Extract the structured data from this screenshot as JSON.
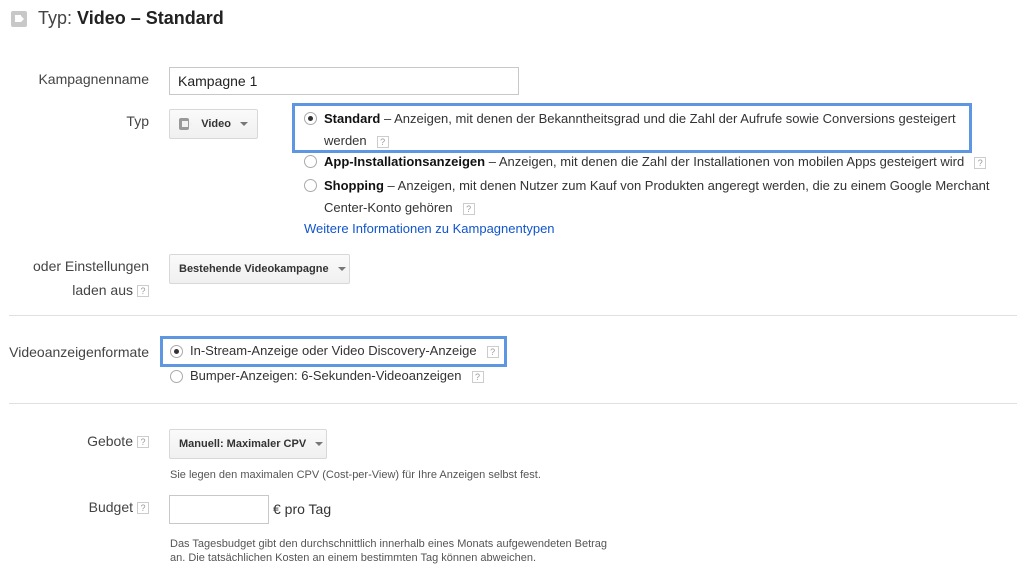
{
  "header": {
    "prefix": "Typ:",
    "title": "Video – Standard"
  },
  "campaign_name": {
    "label": "Kampagnenname",
    "value": "Kampagne 1"
  },
  "type": {
    "label": "Typ",
    "dropdown_value": "Video",
    "options": [
      {
        "title": "Standard",
        "desc_line1": " – Anzeigen, mit denen der Bekanntheitsgrad und die Zahl der Aufrufe sowie Conversions gesteigert",
        "desc_line2": "werden",
        "selected": true
      },
      {
        "title": "App-Installationsanzeigen",
        "desc_line1": " – Anzeigen, mit denen die Zahl der Installationen von mobilen Apps gesteigert wird",
        "selected": false
      },
      {
        "title": "Shopping",
        "desc_line1": " – Anzeigen, mit denen Nutzer zum Kauf von Produkten angeregt werden, die zu einem Google Merchant",
        "desc_line2": "Center-Konto gehören",
        "selected": false
      }
    ],
    "more_info_link": "Weitere Informationen zu Kampagnentypen"
  },
  "load_settings": {
    "label_line1": "oder Einstellungen",
    "label_line2": "laden aus",
    "dropdown_value": "Bestehende Videokampagne"
  },
  "ad_formats": {
    "label": "Videoanzeigenformate",
    "options": [
      {
        "label": "In-Stream-Anzeige oder Video Discovery-Anzeige",
        "selected": true
      },
      {
        "label": "Bumper-Anzeigen: 6-Sekunden-Videoanzeigen",
        "selected": false
      }
    ]
  },
  "bids": {
    "label": "Gebote",
    "dropdown_value": "Manuell: Maximaler CPV",
    "note": "Sie legen den maximalen CPV (Cost-per-View) für Ihre Anzeigen selbst fest."
  },
  "budget": {
    "label": "Budget",
    "value": "",
    "unit": "€ pro Tag",
    "note_line1": "Das Tagesbudget gibt den durchschnittlich innerhalb eines Monats aufgewendeten Betrag",
    "note_line2": "an. Die tatsächlichen Kosten an einem bestimmten Tag können abweichen."
  },
  "help_glyph": "?",
  "colors": {
    "highlight": "#5d97e2",
    "link": "#1155cc"
  }
}
